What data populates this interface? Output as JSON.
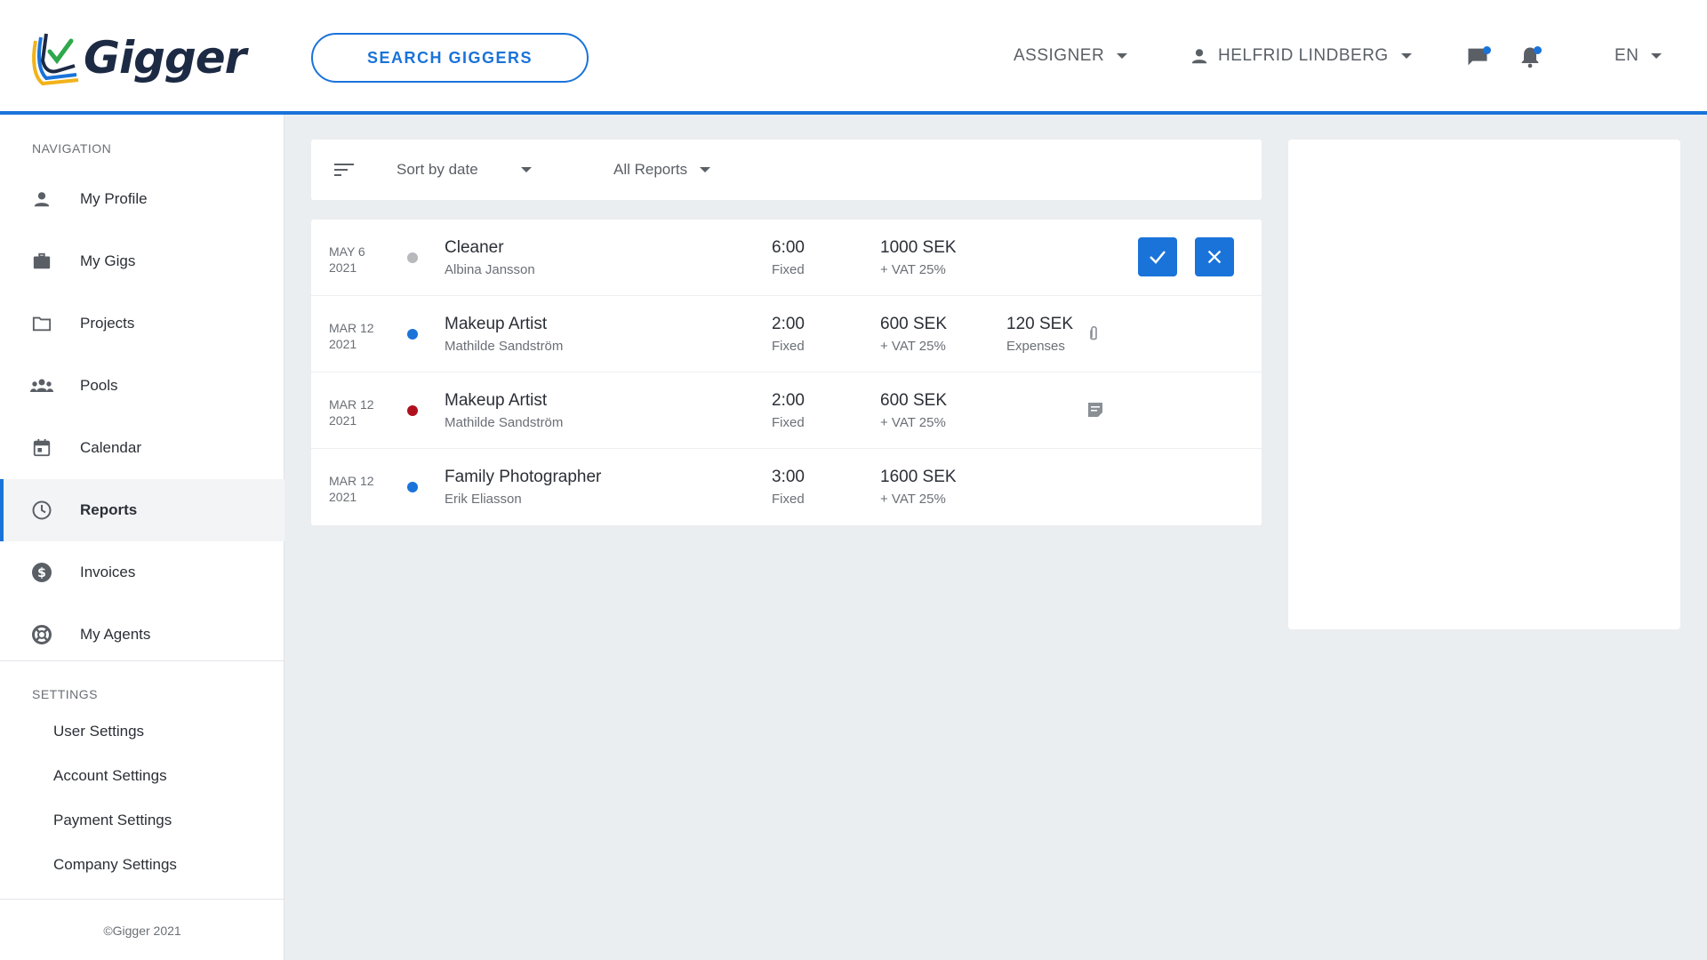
{
  "header": {
    "logo_text": "Gigger",
    "search_label": "SEARCH GIGGERS",
    "role": "ASSIGNER",
    "user_name": "HELFRID LINDBERG",
    "language": "EN"
  },
  "sidebar": {
    "nav_title": "NAVIGATION",
    "items": [
      {
        "label": "My Profile",
        "icon": "person-icon"
      },
      {
        "label": "My Gigs",
        "icon": "briefcase-icon"
      },
      {
        "label": "Projects",
        "icon": "folder-icon"
      },
      {
        "label": "Pools",
        "icon": "group-icon"
      },
      {
        "label": "Calendar",
        "icon": "calendar-icon"
      },
      {
        "label": "Reports",
        "icon": "clock-icon",
        "active": true
      },
      {
        "label": "Invoices",
        "icon": "dollar-icon"
      },
      {
        "label": "My Agents",
        "icon": "lifebuoy-icon"
      }
    ],
    "settings_title": "SETTINGS",
    "settings": [
      {
        "label": "User Settings"
      },
      {
        "label": "Account Settings"
      },
      {
        "label": "Payment Settings"
      },
      {
        "label": "Company Settings"
      }
    ],
    "copyright": "©Gigger 2021"
  },
  "filters": {
    "sort_label": "Sort by date",
    "report_filter": "All Reports"
  },
  "reports": [
    {
      "date_top": "MAY 6",
      "date_year": "2021",
      "status_color": "#b7b9bc",
      "title": "Cleaner",
      "person": "Albina Jansson",
      "time": "6:00",
      "rate_type": "Fixed",
      "amount": "1000 SEK",
      "vat": "+ VAT 25%",
      "expense": "",
      "expense_label": "",
      "extra_icon": "",
      "actions": true
    },
    {
      "date_top": "MAR 12",
      "date_year": "2021",
      "status_color": "#1a73d9",
      "title": "Makeup Artist",
      "person": "Mathilde Sandström",
      "time": "2:00",
      "rate_type": "Fixed",
      "amount": "600 SEK",
      "vat": "+ VAT 25%",
      "expense": "120 SEK",
      "expense_label": "Expenses",
      "extra_icon": "paperclip-icon",
      "actions": false
    },
    {
      "date_top": "MAR 12",
      "date_year": "2021",
      "status_color": "#b0101e",
      "title": "Makeup Artist",
      "person": "Mathilde Sandström",
      "time": "2:00",
      "rate_type": "Fixed",
      "amount": "600 SEK",
      "vat": "+ VAT 25%",
      "expense": "",
      "expense_label": "",
      "extra_icon": "note-icon",
      "actions": false
    },
    {
      "date_top": "MAR 12",
      "date_year": "2021",
      "status_color": "#1a73d9",
      "title": "Family Photographer",
      "person": "Erik Eliasson",
      "time": "3:00",
      "rate_type": "Fixed",
      "amount": "1600 SEK",
      "vat": "+ VAT 25%",
      "expense": "",
      "expense_label": "",
      "extra_icon": "",
      "actions": false
    }
  ],
  "colors": {
    "accent": "#1a73d9",
    "background": "#ebeef1",
    "status_grey": "#b7b9bc",
    "status_blue": "#1a73d9",
    "status_red": "#b0101e"
  }
}
